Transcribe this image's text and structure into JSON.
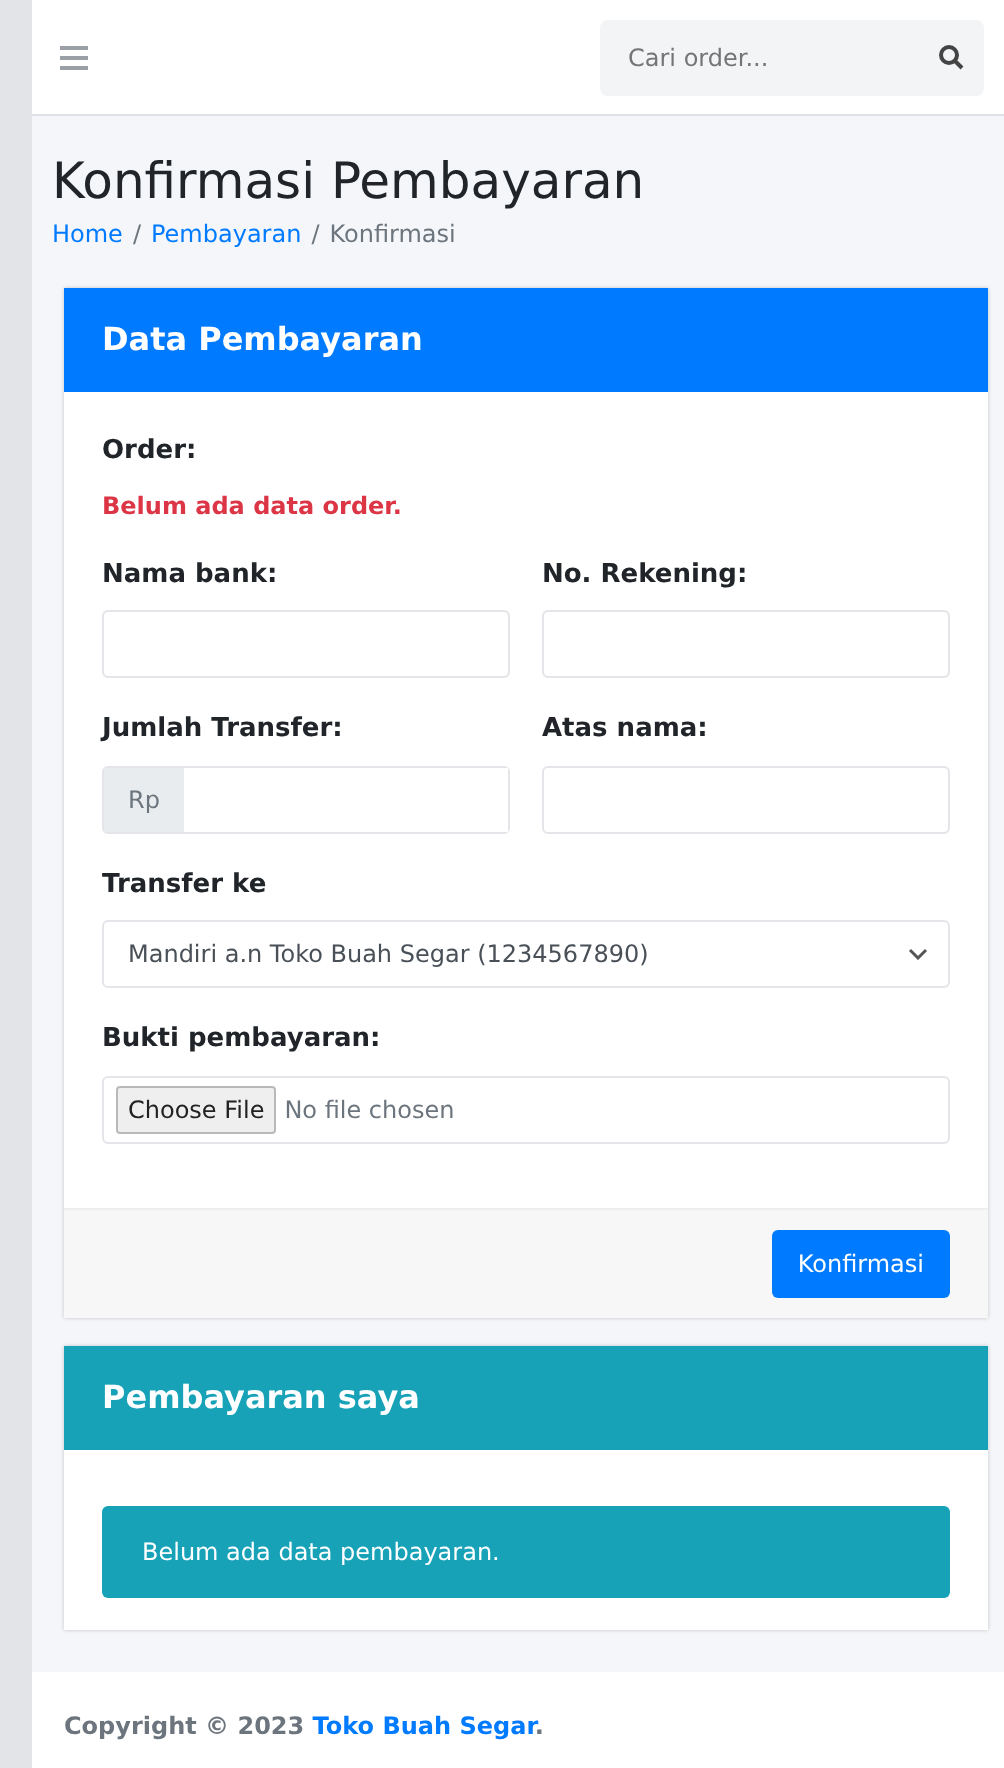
{
  "navbar": {
    "search": {
      "placeholder": "Cari order..."
    }
  },
  "page": {
    "title": "Konfirmasi Pembayaran",
    "breadcrumb_separator": "/",
    "breadcrumb": [
      {
        "label": "Home",
        "link": true
      },
      {
        "label": "Pembayaran",
        "link": true
      },
      {
        "label": "Konfirmasi",
        "link": false
      }
    ]
  },
  "payment_card": {
    "title": "Data Pembayaran",
    "order_label": "Order:",
    "order_status": "Belum ada data order.",
    "fields": [
      {
        "label": "Nama bank:",
        "kind": "text"
      },
      {
        "label": "No. Rekening:",
        "kind": "text"
      },
      {
        "label": "Jumlah Transfer:",
        "kind": "currency",
        "prefix": "Rp"
      },
      {
        "label": "Atas nama:",
        "kind": "text"
      },
      {
        "label": "Transfer ke",
        "kind": "select",
        "value": "Mandiri a.n Toko Buah Segar (1234567890)"
      },
      {
        "label": "Bukti pembayaran:",
        "kind": "file",
        "button": "Choose File",
        "status": "No file chosen"
      }
    ],
    "submit": "Konfirmasi"
  },
  "my_payments_card": {
    "title": "Pembayaran saya",
    "alert": "Belum ada data pembayaran."
  },
  "footer": {
    "text_before": "Copyright © 2023 ",
    "link": "Toko Buah Segar",
    "text_after": "."
  }
}
